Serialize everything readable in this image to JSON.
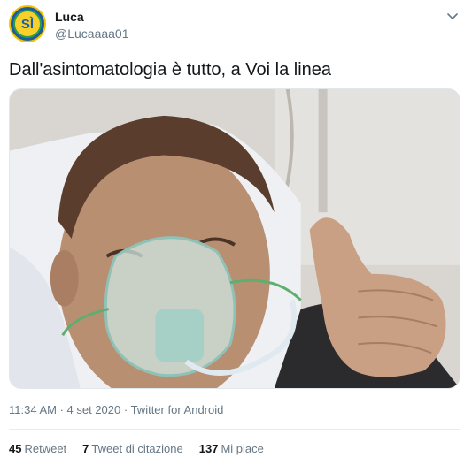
{
  "author": {
    "display_name": "Luca",
    "handle": "@Lucaaaa01",
    "avatar_text": "SÌ"
  },
  "tweet": {
    "text": "Dall'asintomatologia è tutto, a Voi la linea",
    "time": "11:34 AM",
    "date": "4 set 2020",
    "separator": " · ",
    "source": "Twitter for Android"
  },
  "stats": [
    {
      "count": "45",
      "label": "Retweet"
    },
    {
      "count": "7",
      "label": "Tweet di citazione"
    },
    {
      "count": "137",
      "label": "Mi piace"
    }
  ],
  "icons": {
    "caret": "chevron-down-icon"
  },
  "colors": {
    "text_primary": "#14171a",
    "text_secondary": "#657786",
    "divider": "#e6ecf0"
  }
}
